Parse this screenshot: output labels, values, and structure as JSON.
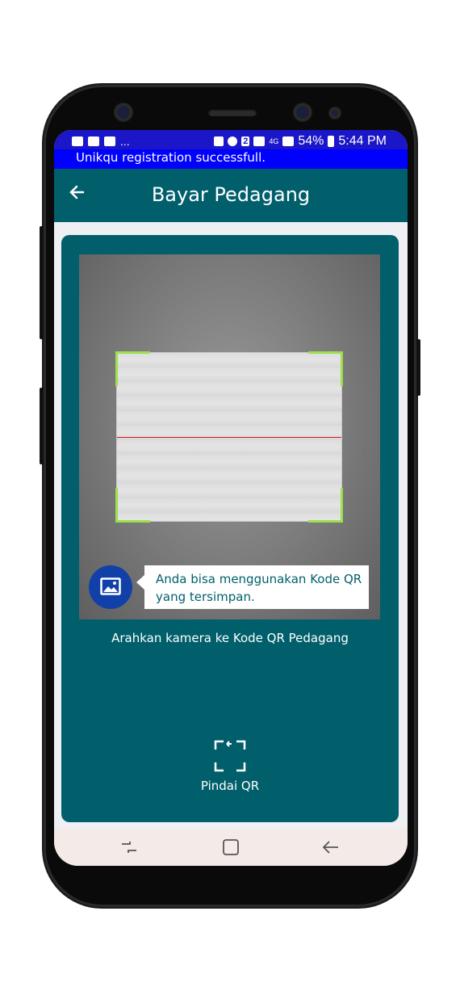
{
  "status_bar": {
    "notifications": "...",
    "sim": "2",
    "network": "4G",
    "battery": "54%",
    "time": "5:44 PM"
  },
  "toast": {
    "message": "Unikqu registration successfull."
  },
  "app_bar": {
    "title": "Bayar Pedagang"
  },
  "scanner": {
    "tip": "Anda bisa menggunakan Kode QR yang tersimpan.",
    "instruction": "Arahkan kamera ke Kode QR Pedagang",
    "scan_label": "Pindai QR"
  },
  "colors": {
    "teal": "#005f6b",
    "status_blue": "#1b16c8",
    "toast_blue": "#0000ff",
    "corner_green": "#9ee04a",
    "scan_line_red": "#d21919",
    "gallery_blue": "#1141a8"
  },
  "icons": [
    "back-arrow-icon",
    "gallery-image-icon",
    "scan-qr-icon",
    "recent-apps-icon",
    "home-icon",
    "back-icon"
  ]
}
